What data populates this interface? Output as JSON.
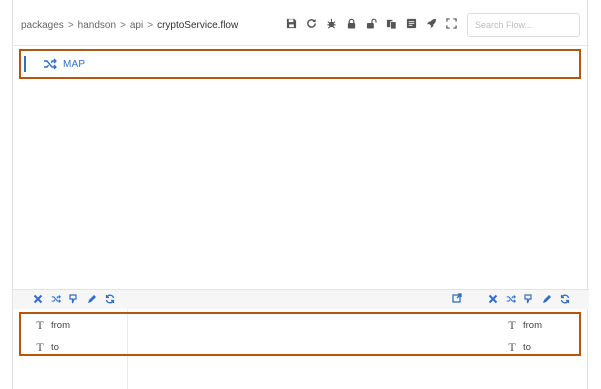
{
  "breadcrumb": {
    "items": [
      "packages",
      "handson",
      "api",
      "cryptoService.flow"
    ],
    "separator": ">"
  },
  "toolbar": {
    "buttons": [
      "save-icon",
      "refresh-icon",
      "debug-icon",
      "lock-icon",
      "unlock-icon",
      "copy-icon",
      "notes-icon",
      "rocket-icon",
      "fullscreen-icon"
    ]
  },
  "search": {
    "placeholder": "Search Flow..."
  },
  "flow": {
    "steps": [
      {
        "label": "MAP",
        "icon": "shuffle-icon"
      }
    ]
  },
  "pipeline": {
    "left_actions": [
      "close-icon",
      "shuffle-icon",
      "drop-icon",
      "pencil-icon",
      "refresh-icon"
    ],
    "right_actions": [
      "close-icon",
      "shuffle-icon",
      "drop-icon",
      "pencil-icon",
      "refresh-icon"
    ],
    "export_icon": "export-icon",
    "input_vars": [
      {
        "type": "T",
        "name": "from"
      },
      {
        "type": "T",
        "name": "to"
      }
    ],
    "output_vars": [
      {
        "type": "T",
        "name": "from"
      },
      {
        "type": "T",
        "name": "to"
      }
    ]
  },
  "colors": {
    "accent": "#2f6fc8",
    "highlight_border": "#b4560e"
  }
}
